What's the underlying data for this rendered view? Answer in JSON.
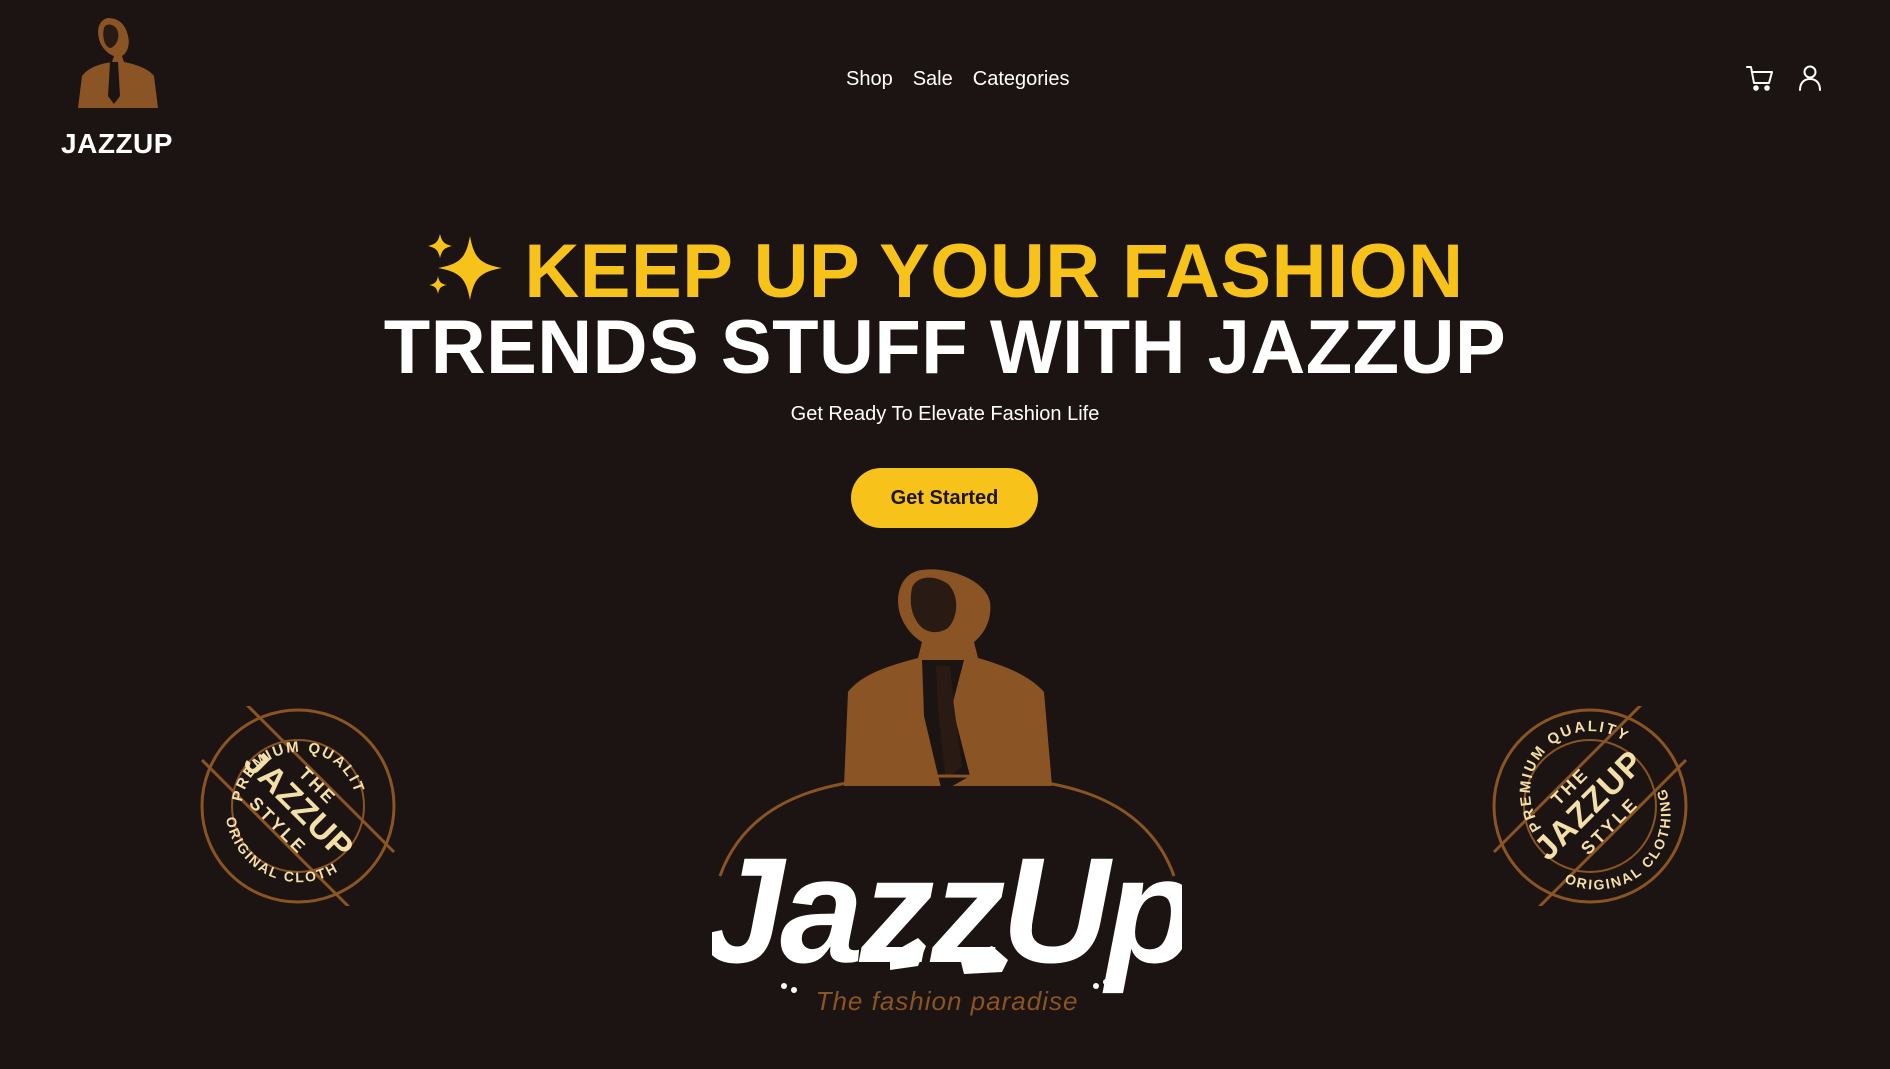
{
  "header": {
    "logo_text": "JAZZUP",
    "nav": [
      "Shop",
      "Sale",
      "Categories"
    ],
    "icons": [
      "cart-icon",
      "user-icon"
    ]
  },
  "hero": {
    "title_line1": "KEEP UP YOUR FASHION",
    "title_line2": "TRENDS STUFF WITH JAZZUP",
    "subtitle": "Get Ready To Elevate Fashion Life",
    "cta_label": "Get Started"
  },
  "badge": {
    "top_text": "PREMIUM QUALITY",
    "bottom_text": "ORIGINAL CLOTHING",
    "center_line1": "THE",
    "center_line2": "JAZZUP",
    "center_line3": "STYLE"
  },
  "brand": {
    "wordmark": "JazzUp",
    "tagline": "The fashion paradise"
  },
  "colors": {
    "background": "#1c1412",
    "accent": "#f7c31a",
    "brown": "#8a5424",
    "cream": "#f3dfa8"
  }
}
